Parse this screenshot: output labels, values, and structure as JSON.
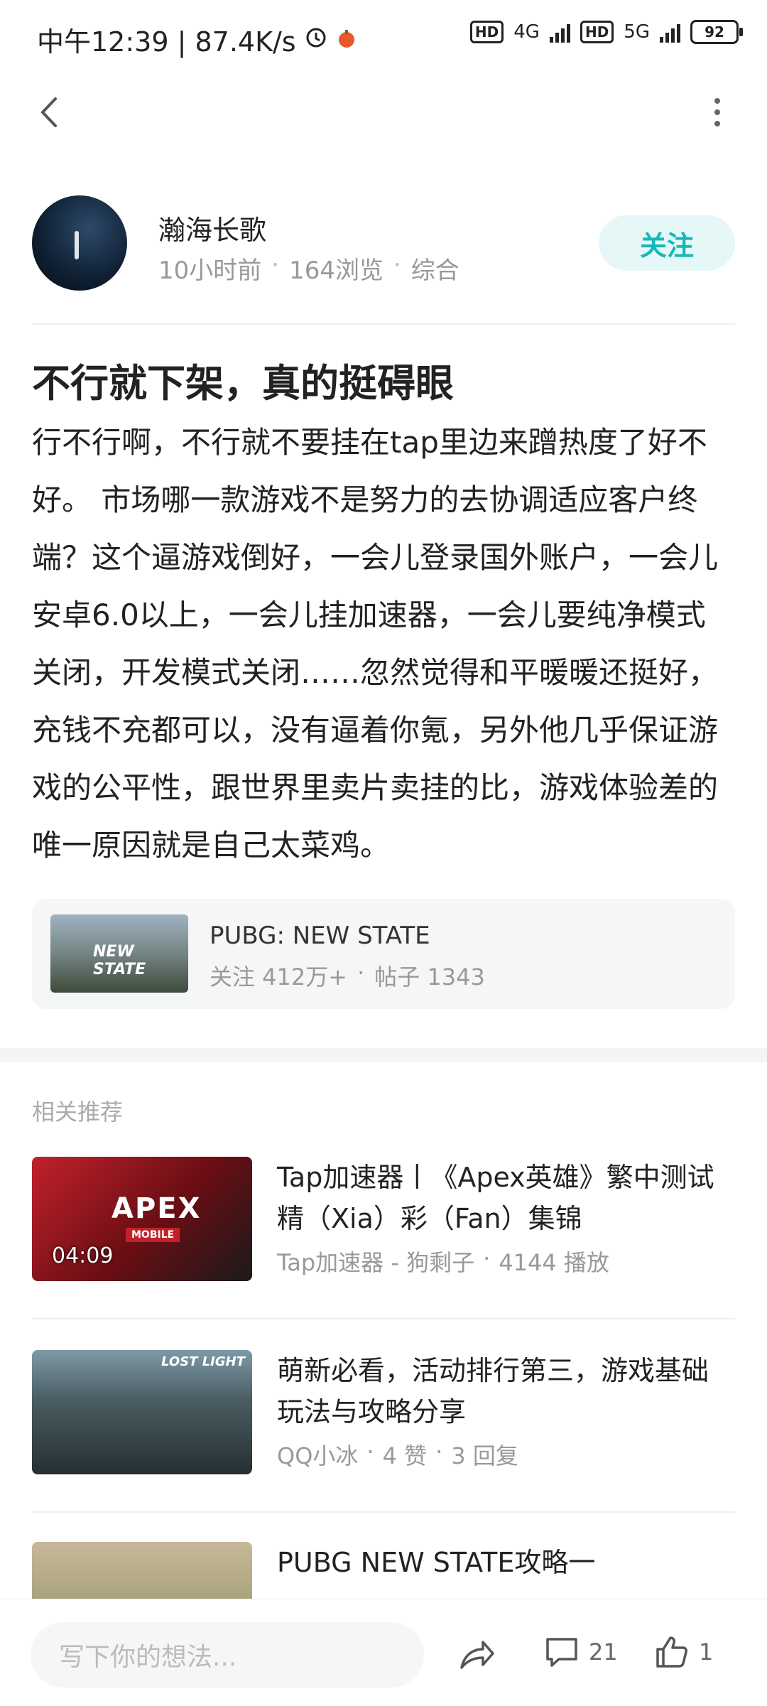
{
  "status": {
    "time_label": "中午12:39 | 87.4K/s",
    "net1": "4G",
    "net2": "5G",
    "hd": "HD",
    "battery": "92"
  },
  "author": {
    "name": "瀚海长歌",
    "time": "10小时前",
    "views": "164浏览",
    "category": "综合",
    "follow_label": "关注",
    "meta_separator": "·"
  },
  "post": {
    "title": "不行就下架，真的挺碍眼",
    "body": "行不行啊，不行就不要挂在tap里边来蹭热度了好不好。 市场哪一款游戏不是努力的去协调适应客户终端？这个逼游戏倒好，一会儿登录国外账户，一会儿安卓6.0以上，一会儿挂加速器，一会儿要纯净模式关闭，开发模式关闭……忽然觉得和平暖暖还挺好，充钱不充都可以，没有逼着你氪，另外他几乎保证游戏的公平性，跟世界里卖片卖挂的比，游戏体验差的唯一原因就是自己太菜鸡。"
  },
  "game_card": {
    "name": "PUBG: NEW STATE",
    "followers": "关注 412万+",
    "posts": "帖子 1343",
    "thumb_text": "NEW STATE"
  },
  "recommend": {
    "title": "相关推荐",
    "items": [
      {
        "headline": "Tap加速器丨《Apex英雄》繁中测试精（Xia）彩（Fan）集锦",
        "meta1": "Tap加速器 - 狗剩子",
        "meta2": "4144 播放",
        "duration": "04:09",
        "thumb_logo": "APEX",
        "thumb_sub": "MOBILE"
      },
      {
        "headline": "萌新必看，活动排行第三，游戏基础玩法与攻略分享",
        "meta1": "QQ小冰",
        "meta2": "4 赞",
        "meta3": "3 回复",
        "thumb_logo": "LOST LIGHT"
      },
      {
        "headline": "PUBG NEW STATE攻略一"
      }
    ]
  },
  "bottom": {
    "placeholder": "写下你的想法...",
    "comment_count": "21",
    "like_count": "1"
  }
}
